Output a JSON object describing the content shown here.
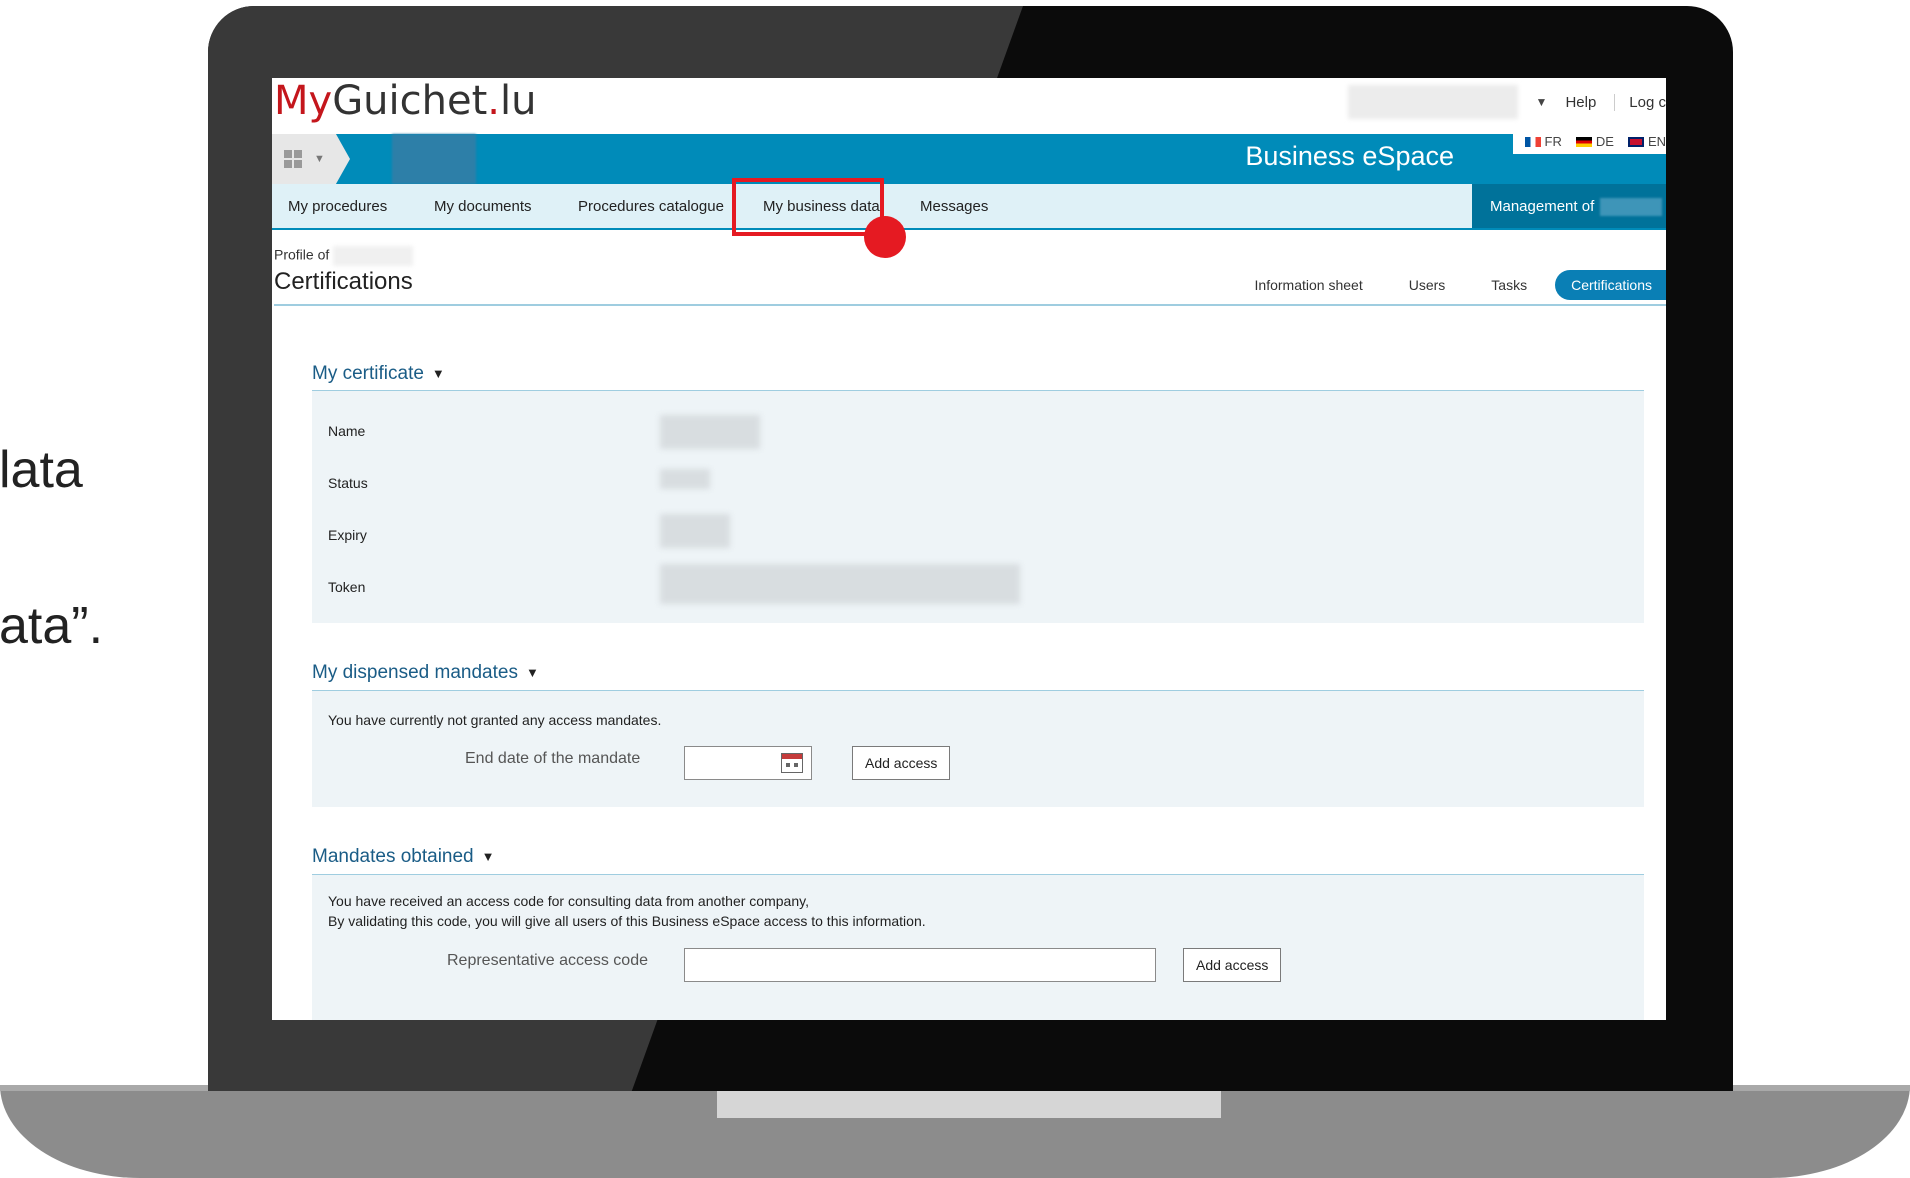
{
  "instruction_fragments": [
    "lata",
    "ata”."
  ],
  "app": {
    "logo_my": "My",
    "logo_guichet": "Guichet",
    "logo_dot": ".",
    "logo_lu": "lu",
    "banner_title": "Business eSpace"
  },
  "header": {
    "help_label": "Help",
    "logout_label": "Log c",
    "languages": [
      "FR",
      "DE",
      "EN"
    ]
  },
  "nav": {
    "items": [
      "My procedures",
      "My documents",
      "Procedures catalogue",
      "My business data",
      "Messages"
    ],
    "management_label": "Management of"
  },
  "page": {
    "profile_of_label": "Profile of",
    "title": "Certifications",
    "subtabs": [
      "Information sheet",
      "Users",
      "Tasks",
      "Certifications"
    ]
  },
  "my_certificate": {
    "title": "My certificate",
    "labels": [
      "Name",
      "Status",
      "Expiry",
      "Token"
    ]
  },
  "dispensed_mandates": {
    "title": "My dispensed mandates",
    "message": "You have currently not granted any access mandates.",
    "end_date_label": "End date of the mandate",
    "add_button": "Add access"
  },
  "mandates_obtained": {
    "title": "Mandates obtained",
    "line1": "You have received an access code for consulting data from another company,",
    "line2": "By validating this code, you will give all users of this Business eSpace access to this information.",
    "code_label": "Representative access code",
    "add_button": "Add access"
  },
  "colors": {
    "brand_red": "#c4161c",
    "banner_blue": "#008bb9",
    "highlight_red": "#e51a22"
  }
}
